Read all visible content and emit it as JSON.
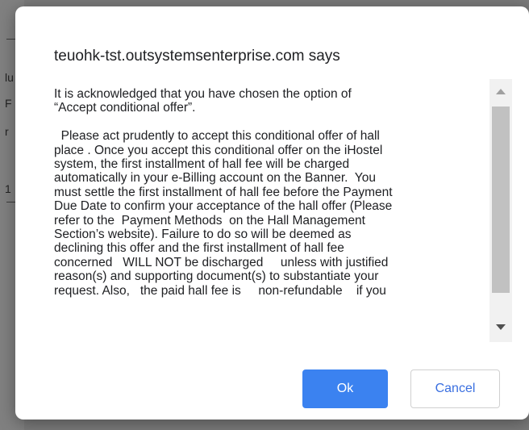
{
  "background": {
    "fragments": [
      "lu",
      "F",
      "r",
      "1"
    ]
  },
  "dialog": {
    "title": "teuohk-tst.outsystemsenterprise.com says",
    "message": "It is acknowledged that you have chosen the option of\n“Accept conditional offer”.\n\n  Please act prudently to accept this conditional offer of hall\nplace . Once you accept this conditional offer on the iHostel\nsystem, the first installment of hall fee will be charged\nautomatically in your e-Billing account on the Banner.  You\nmust settle the first installment of hall fee before the Payment\nDue Date to confirm your acceptance of the hall offer (Please\nrefer to the  Payment Methods  on the Hall Management\nSection’s website). Failure to do so will be deemed as\ndeclining this offer and the first installment of hall fee\nconcerned   WILL NOT be discharged     unless with justified\nreason(s) and supporting document(s) to substantiate your\nrequest. Also,   the paid hall fee is     non-refundable    if you",
    "ok_label": "Ok",
    "cancel_label": "Cancel"
  },
  "colors": {
    "ok_button": "#3b82f0",
    "cancel_text": "#3a6fe0",
    "overlay": "#7a7a7a"
  },
  "icons": {
    "scroll_up": "triangle-up",
    "scroll_down": "triangle-down"
  }
}
